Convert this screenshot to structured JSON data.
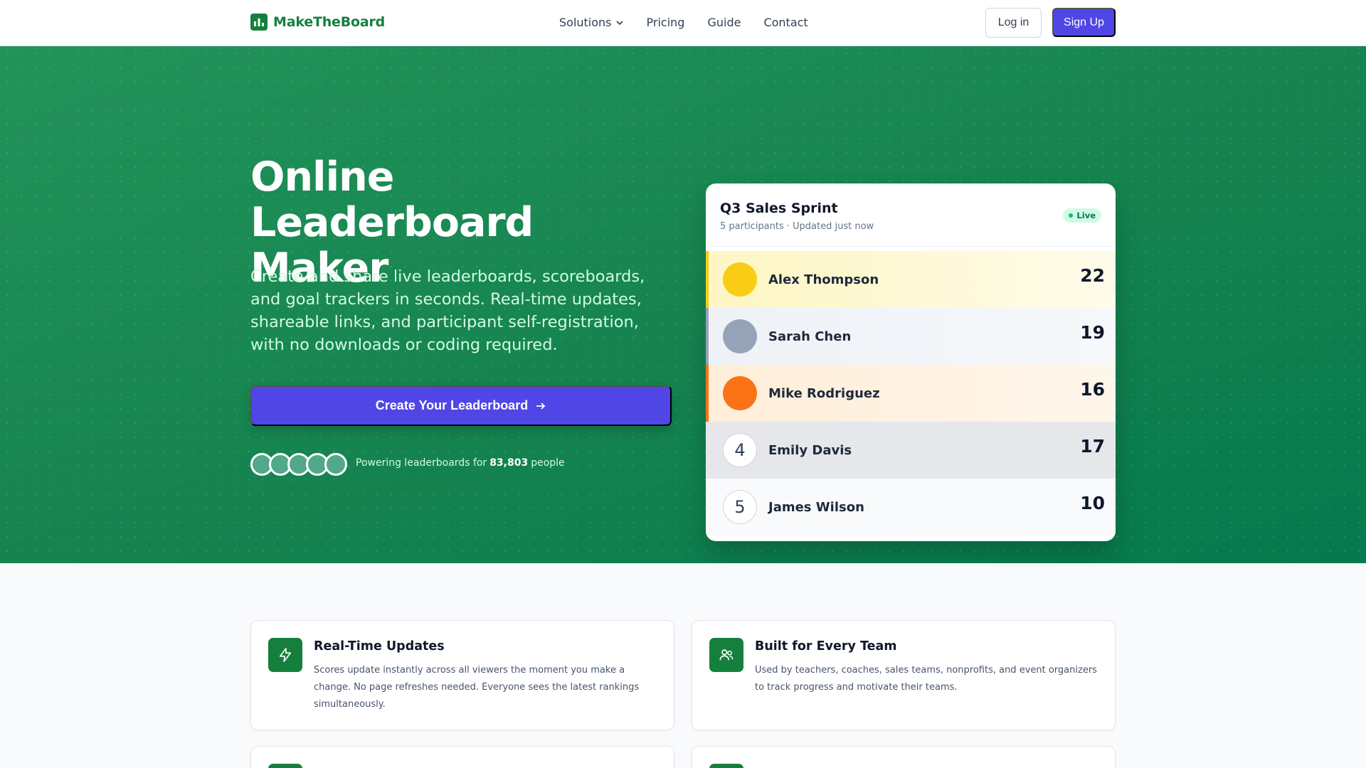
{
  "nav": {
    "brand": "MakeTheBoard",
    "links": [
      "Solutions",
      "Pricing",
      "Guide",
      "Contact"
    ],
    "login": "Log in",
    "signup": "Sign Up"
  },
  "hero": {
    "title": "Online Leaderboard Maker",
    "subtitle": "Create and share live leaderboards, scoreboards, and goal trackers in seconds. Real-time updates, shareable links, and participant self-registration, with no downloads or coding required.",
    "cta": "Create Your Leaderboard",
    "social_prefix": "Powering leaderboards for",
    "social_count": "83,803",
    "social_suffix": "people"
  },
  "leaderboard": {
    "title": "Q3 Sales Sprint",
    "participants": "5 participants",
    "updated": "· Updated just now",
    "status": "Live",
    "rows": [
      {
        "rank": "",
        "name": "Alex Thompson",
        "score": "22"
      },
      {
        "rank": "",
        "name": "Sarah Chen",
        "score": "19"
      },
      {
        "rank": "",
        "name": "Mike Rodriguez",
        "score": "16"
      },
      {
        "rank": "4",
        "name": "Emily Davis",
        "score": "17"
      },
      {
        "rank": "5",
        "name": "James Wilson",
        "score": "10"
      }
    ]
  },
  "features": [
    {
      "title": "Real-Time Updates",
      "description": "Scores update instantly across all viewers the moment you make a change. No page refreshes needed. Everyone sees the latest rankings simultaneously.",
      "icon": "lightning-icon"
    },
    {
      "title": "Built for Every Team",
      "description": "Used by teachers, coaches, sales teams, nonprofits, and event organizers to track progress and motivate their teams.",
      "icon": "users-icon"
    }
  ],
  "colors": {
    "brand_green": "#15803d",
    "accent_indigo": "#4f46e5",
    "gold": "#facc15",
    "silver": "#94a3b8",
    "bronze": "#f97316"
  }
}
